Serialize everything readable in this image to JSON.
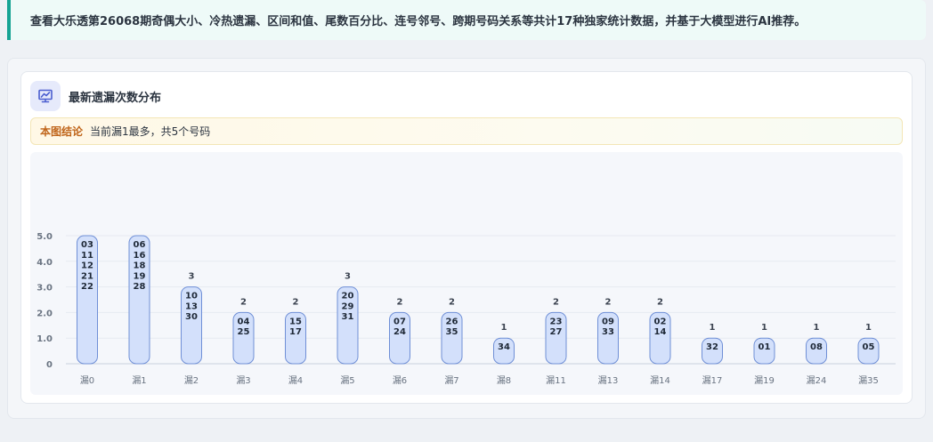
{
  "banner": {
    "text": "查看大乐透第26068期奇偶大小、冷热遗漏、区间和值、尾数百分比、连号邻号、跨期号码关系等共计17种独家统计数据，并基于大模型进行AI推荐。"
  },
  "card": {
    "icon": "chart-line-icon",
    "title": "最新遗漏次数分布",
    "conclusion_tag": "本图结论",
    "conclusion_text": "当前漏1最多，共5个号码"
  },
  "colors": {
    "bar_fill": "#d3e0fb",
    "bar_stroke": "#6f8fd6",
    "accent": "#16a394"
  },
  "chart_data": {
    "type": "bar",
    "categories": [
      "漏0",
      "漏1",
      "漏2",
      "漏3",
      "漏4",
      "漏5",
      "漏6",
      "漏7",
      "漏8",
      "漏11",
      "漏13",
      "漏14",
      "漏17",
      "漏19",
      "漏24",
      "漏35"
    ],
    "values": [
      5,
      5,
      3,
      2,
      2,
      3,
      2,
      2,
      1,
      2,
      2,
      2,
      1,
      1,
      1,
      1
    ],
    "value_labels": [
      "",
      "",
      "3",
      "2",
      "2",
      "3",
      "2",
      "2",
      "1",
      "2",
      "2",
      "2",
      "1",
      "1",
      "1",
      "1"
    ],
    "numbers": [
      [
        "03",
        "11",
        "12",
        "21",
        "22"
      ],
      [
        "06",
        "16",
        "18",
        "19",
        "28"
      ],
      [
        "10",
        "13",
        "30"
      ],
      [
        "04",
        "25"
      ],
      [
        "15",
        "17"
      ],
      [
        "20",
        "29",
        "31"
      ],
      [
        "07",
        "24"
      ],
      [
        "26",
        "35"
      ],
      [
        "34"
      ],
      [
        "23",
        "27"
      ],
      [
        "09",
        "33"
      ],
      [
        "02",
        "14"
      ],
      [
        "32"
      ],
      [
        "01"
      ],
      [
        "08"
      ],
      [
        "05"
      ]
    ],
    "yticks": [
      "0",
      "1.0",
      "2.0",
      "3.0",
      "4.0",
      "5.0"
    ],
    "ylim": [
      0,
      5
    ],
    "grid": true
  }
}
